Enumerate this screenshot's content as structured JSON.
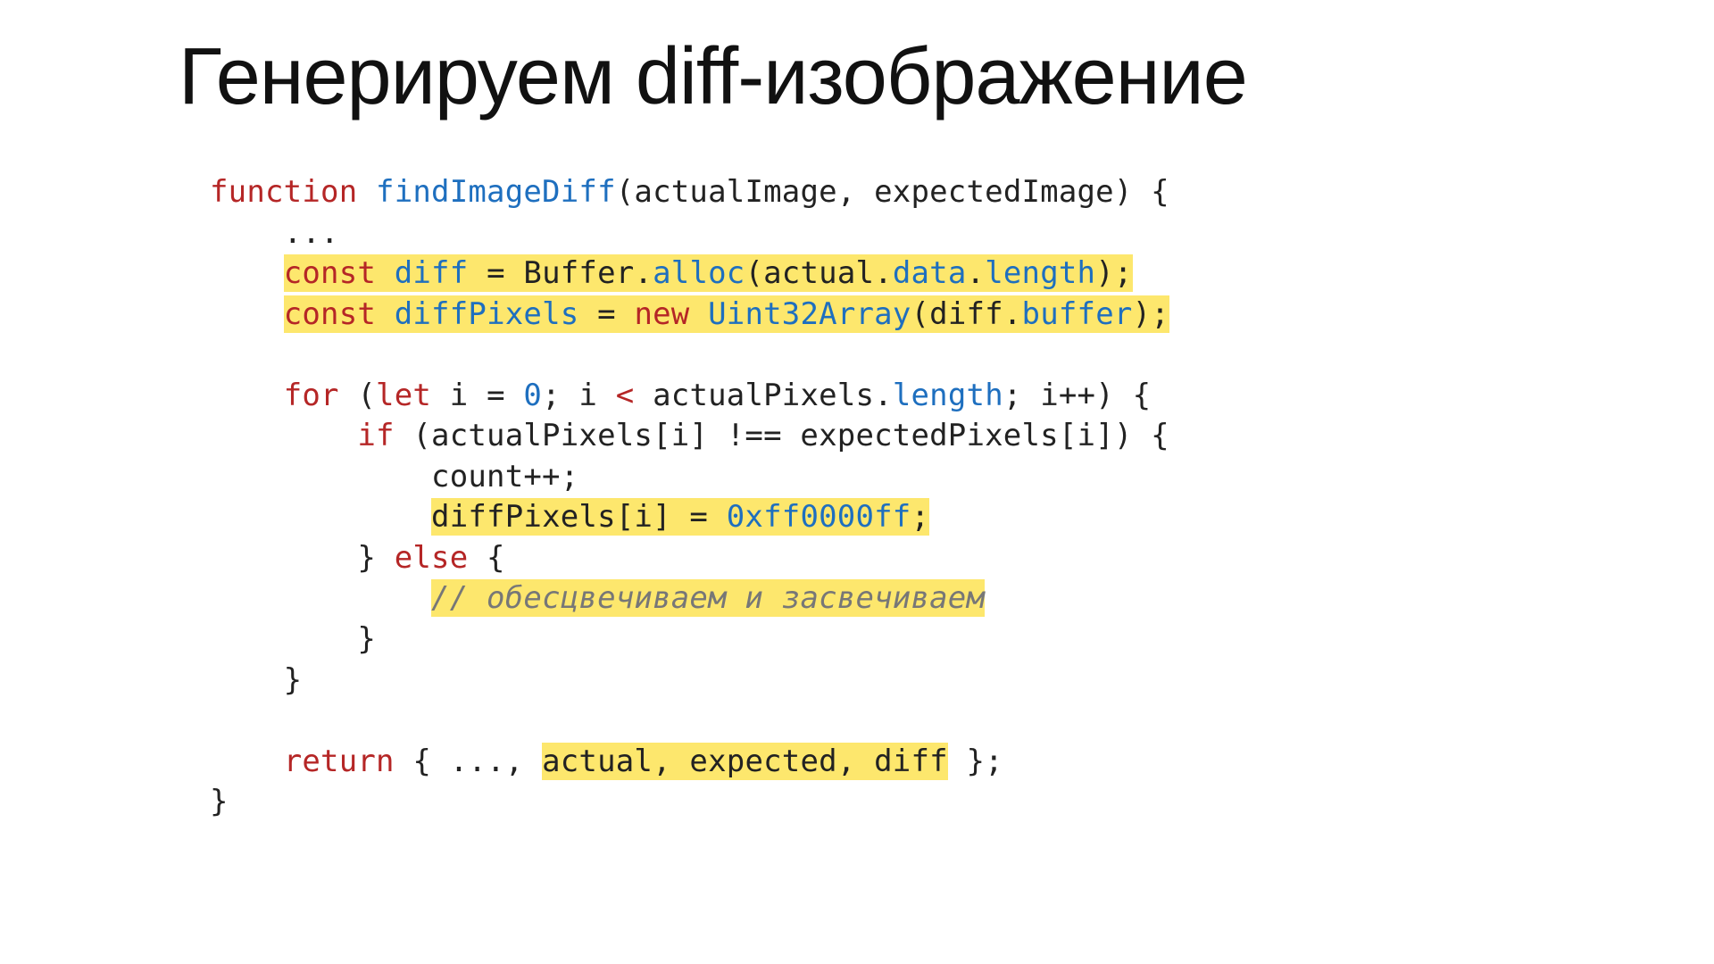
{
  "slide": {
    "title": "Генерируем diff-изображение",
    "code": {
      "l1_fn": "function",
      "l1_name": "findImageDiff",
      "l1_rest": "(actualImage, expectedImage) {",
      "l2": "    ...",
      "l3_const": "const",
      "l3_diff": "diff",
      "l3_eq": " = Buffer.",
      "l3_alloc": "alloc",
      "l3_p1": "(actual.",
      "l3_data": "data",
      "l3_dot": ".",
      "l3_len": "length",
      "l3_end": ");",
      "l4_const": "const",
      "l4_dp": "diffPixels",
      "l4_eq": " = ",
      "l4_new": "new",
      "l4_sp": " ",
      "l4_u32": "Uint32Array",
      "l4_p1": "(diff.",
      "l4_buf": "buffer",
      "l4_end": ");",
      "l5_for": "for",
      "l5_p1": " (",
      "l5_let": "let",
      "l5_i": " i = ",
      "l5_zero": "0",
      "l5_semi": "; i ",
      "l5_lt": "<",
      "l5_ap": " actualPixels.",
      "l5_len": "length",
      "l5_end": "; i++) {",
      "l6_if": "if",
      "l6_rest": " (actualPixels[i] !== expectedPixels[i]) {",
      "l7": "            count++;",
      "l8_pre": "            ",
      "l8_dp": "diffPixels[i] = ",
      "l8_hex": "0xff0000ff",
      "l8_end": ";",
      "l9_cb": "        } ",
      "l9_else": "else",
      "l9_ob": " {",
      "l10_pre": "            ",
      "l10_comment": "// обесцвечиваем и засвечиваем",
      "l11": "        }",
      "l12": "    }",
      "l13_ret": "return",
      "l13_p1": " { ..., ",
      "l13_hl": "actual, expected, diff",
      "l13_end": " };",
      "l14": "}"
    }
  }
}
